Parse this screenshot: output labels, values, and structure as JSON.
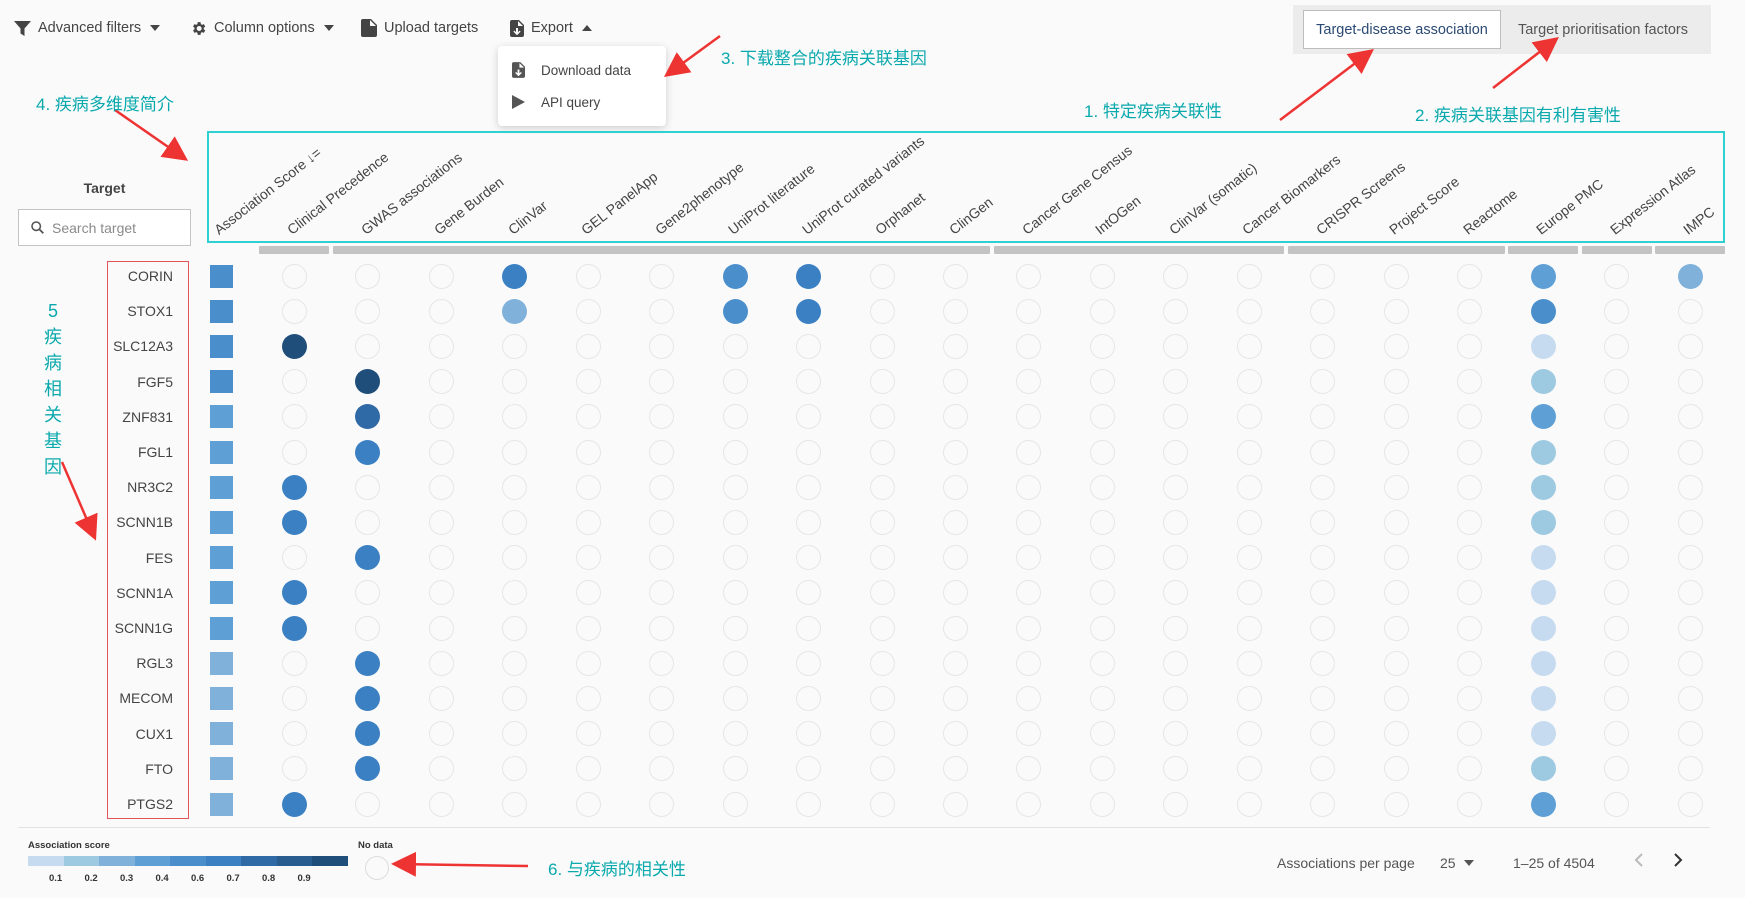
{
  "toolbar": {
    "filters": "Advanced filters",
    "columns": "Column options",
    "upload": "Upload targets",
    "export": "Export"
  },
  "export_menu": [
    {
      "label": "Download data",
      "icon": "download-file-icon"
    },
    {
      "label": "API query",
      "icon": "play-icon"
    }
  ],
  "view_tabs": [
    {
      "label": "Target-disease association",
      "active": true
    },
    {
      "label": "Target prioritisation factors",
      "active": false
    }
  ],
  "annotations": {
    "a1": "1. 特定疾病关联性",
    "a2": "2. 疾病关联基因有利有害性",
    "a3": "3. 下载整合的疾病关联基因",
    "a4": "4. 疾病多维度简介",
    "a5": [
      "5",
      "疾",
      "病",
      "相",
      "关",
      "基",
      "因"
    ],
    "a6": "6. 与疾病的相关性"
  },
  "target": {
    "title": "Target",
    "search_placeholder": "Search target"
  },
  "columns": [
    "Association Score ↓=",
    "Clinical Precedence",
    "GWAS associations",
    "Gene Burden",
    "ClinVar",
    "GEL PanelApp",
    "Gene2phenotype",
    "UniProt literature",
    "UniProt curated variants",
    "Orphanet",
    "ClinGen",
    "Cancer Gene Census",
    "IntOGen",
    "ClinVar (somatic)",
    "Cancer Biomarkers",
    "CRISPR Screens",
    "Project Score",
    "Reactome",
    "Europe PMC",
    "Expression Atlas",
    "IMPC"
  ],
  "rows": [
    {
      "gene": "CORIN",
      "score": 5,
      "cells": {
        "4": 6,
        "7": 5,
        "8": 6,
        "18": 4,
        "20": 3
      }
    },
    {
      "gene": "STOX1",
      "score": 5,
      "cells": {
        "4": 3,
        "7": 5,
        "8": 6,
        "18": 5
      }
    },
    {
      "gene": "SLC12A3",
      "score": 5,
      "cells": {
        "1": 9,
        "18": 1
      }
    },
    {
      "gene": "FGF5",
      "score": 5,
      "cells": {
        "2": 9,
        "18": 2
      }
    },
    {
      "gene": "ZNF831",
      "score": 4,
      "cells": {
        "2": 7,
        "18": 4
      }
    },
    {
      "gene": "FGL1",
      "score": 4,
      "cells": {
        "2": 6,
        "18": 2
      }
    },
    {
      "gene": "NR3C2",
      "score": 4,
      "cells": {
        "1": 6,
        "18": 2
      }
    },
    {
      "gene": "SCNN1B",
      "score": 4,
      "cells": {
        "1": 6,
        "18": 2
      }
    },
    {
      "gene": "FES",
      "score": 4,
      "cells": {
        "2": 6,
        "18": 1
      }
    },
    {
      "gene": "SCNN1A",
      "score": 4,
      "cells": {
        "1": 6,
        "18": 1
      }
    },
    {
      "gene": "SCNN1G",
      "score": 4,
      "cells": {
        "1": 6,
        "18": 1
      }
    },
    {
      "gene": "RGL3",
      "score": 3,
      "cells": {
        "2": 6,
        "18": 1
      }
    },
    {
      "gene": "MECOM",
      "score": 3,
      "cells": {
        "2": 6,
        "18": 1
      }
    },
    {
      "gene": "CUX1",
      "score": 3,
      "cells": {
        "2": 6,
        "18": 1
      }
    },
    {
      "gene": "FTO",
      "score": 3,
      "cells": {
        "2": 6,
        "18": 2
      }
    },
    {
      "gene": "PTGS2",
      "score": 3,
      "cells": {
        "1": 6,
        "18": 4
      }
    }
  ],
  "colors": {
    "palette": [
      "#deebf7",
      "#c6dbef",
      "#9ecae1",
      "#7fb1da",
      "#5e9fd6",
      "#4a8fcc",
      "#3b80c2",
      "#2f6aa6",
      "#295d8f",
      "#1f4e7a"
    ]
  },
  "legend": {
    "title": "Association score",
    "ticks": [
      "0.1",
      "0.2",
      "0.3",
      "0.4",
      "0.6",
      "0.7",
      "0.8",
      "0.9"
    ],
    "nodata": "No data"
  },
  "pagination": {
    "per_page_label": "Associations per page",
    "per_page": "25",
    "range": "1–25 of 4504"
  }
}
